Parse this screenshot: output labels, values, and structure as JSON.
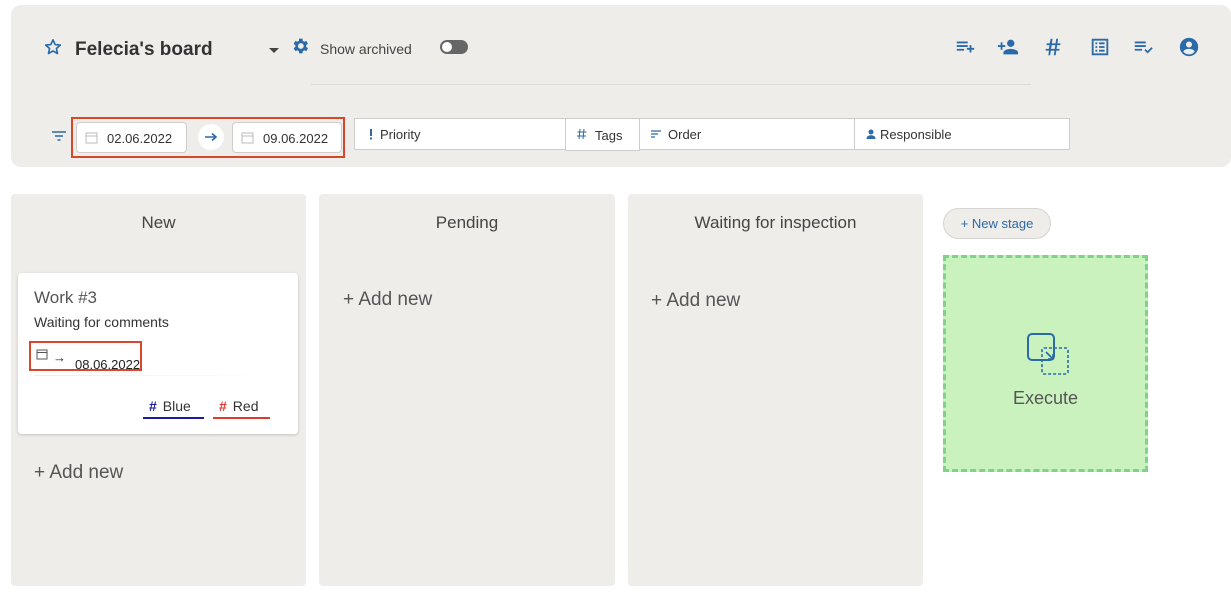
{
  "board": {
    "title": "Felecia's board",
    "show_archived_label": "Show archived",
    "show_archived": false,
    "tool_icons": [
      "add-list-icon",
      "add-person-icon",
      "hashtag-icon",
      "list-view-icon",
      "checklist-icon",
      "account-icon"
    ]
  },
  "filters": {
    "date_from": "02.06.2022",
    "date_to": "09.06.2022",
    "priority_label": "Priority",
    "tags_label": "Tags",
    "order_label": "Order",
    "responsible_label": "Responsible"
  },
  "columns": [
    {
      "title": "New",
      "add_new_label": "+ Add new",
      "cards": [
        {
          "title": "Work #3",
          "subtitle": "Waiting for comments",
          "date": "08.06.2022",
          "date_arrow": "→",
          "tags": [
            {
              "hash": "#",
              "label": "Blue",
              "color": "#1a1aa6"
            },
            {
              "hash": "#",
              "label": "Red",
              "color": "#e03a2f"
            }
          ]
        }
      ]
    },
    {
      "title": "Pending",
      "add_new_label": "+ Add new",
      "cards": []
    },
    {
      "title": "Waiting for inspection",
      "add_new_label": "+ Add new",
      "cards": []
    }
  ],
  "new_stage_label": "+ New stage",
  "execute_label": "Execute",
  "colors": {
    "accent": "#2a6aa8",
    "highlight": "#d9472a",
    "panel": "#efedea",
    "execute_bg": "#caf2bf"
  }
}
